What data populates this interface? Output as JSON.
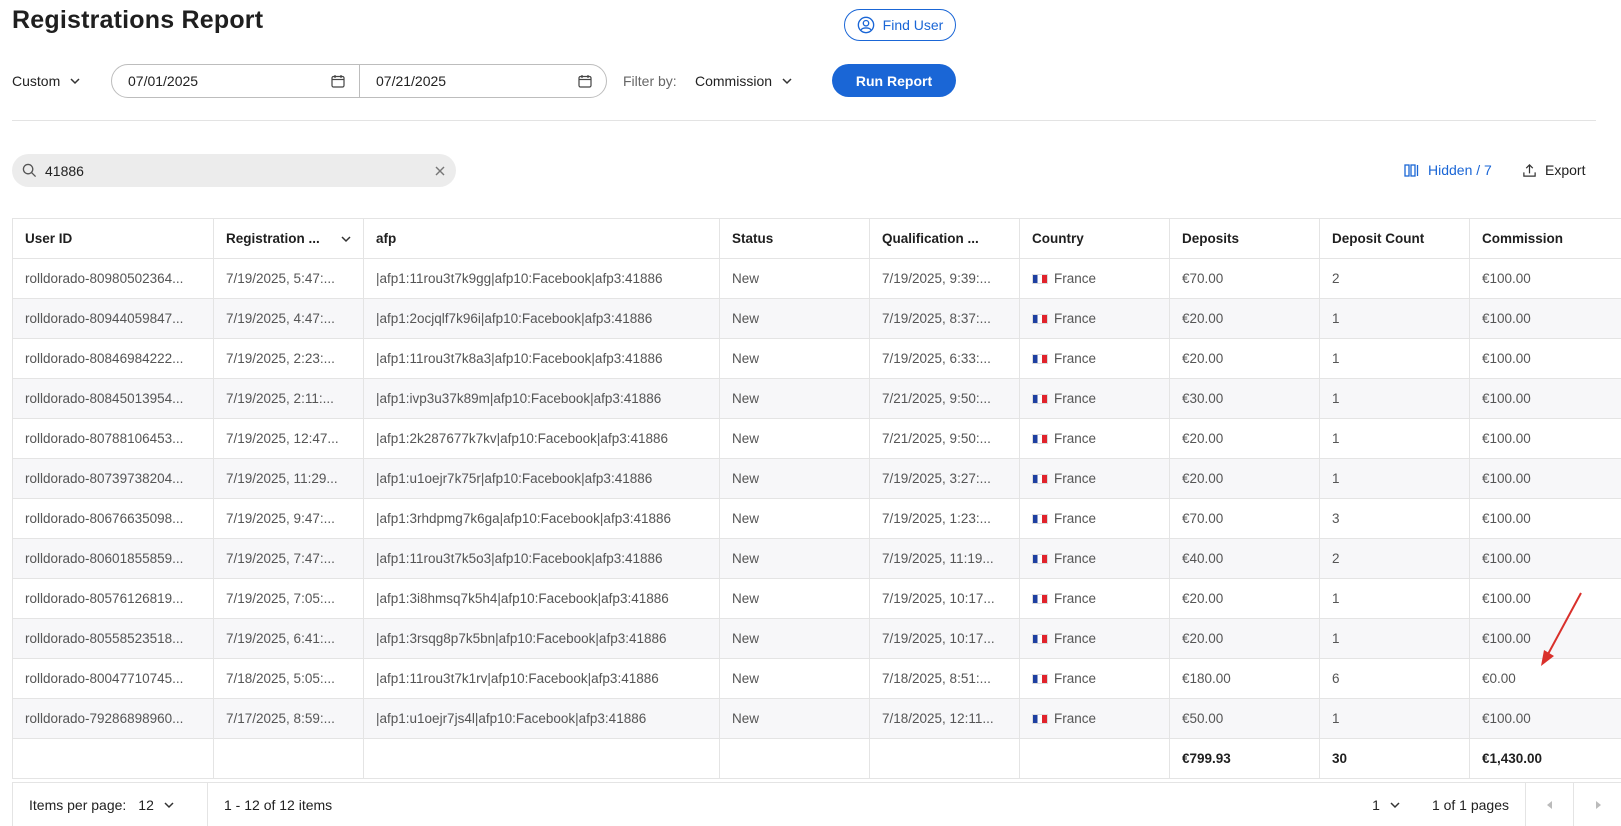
{
  "page": {
    "title": "Registrations Report"
  },
  "find_user": {
    "label": "Find User",
    "icon": "user-circle-icon"
  },
  "toolbar": {
    "range_label": "Custom",
    "start_date": "07/01/2025",
    "end_date": "07/21/2025",
    "filter_label": "Filter by:",
    "filter_value": "Commission",
    "run_label": "Run Report"
  },
  "search": {
    "value": "41886"
  },
  "actions": {
    "hidden_label": "Hidden / 7",
    "export_label": "Export"
  },
  "table": {
    "columns": [
      "User ID",
      "Registration ...",
      "afp",
      "Status",
      "Qualification ...",
      "Country",
      "Deposits",
      "Deposit Count",
      "Commission"
    ],
    "rows": [
      [
        "rolldorado-80980502364...",
        "7/19/2025, 5:47:...",
        "|afp1:11rou3t7k9gg|afp10:Facebook|afp3:41886",
        "New",
        "7/19/2025, 9:39:...",
        "France",
        "€70.00",
        "2",
        "€100.00"
      ],
      [
        "rolldorado-80944059847...",
        "7/19/2025, 4:47:...",
        "|afp1:2ocjqlf7k96i|afp10:Facebook|afp3:41886",
        "New",
        "7/19/2025, 8:37:...",
        "France",
        "€20.00",
        "1",
        "€100.00"
      ],
      [
        "rolldorado-80846984222...",
        "7/19/2025, 2:23:...",
        "|afp1:11rou3t7k8a3|afp10:Facebook|afp3:41886",
        "New",
        "7/19/2025, 6:33:...",
        "France",
        "€20.00",
        "1",
        "€100.00"
      ],
      [
        "rolldorado-80845013954...",
        "7/19/2025, 2:11:...",
        "|afp1:ivp3u37k89m|afp10:Facebook|afp3:41886",
        "New",
        "7/21/2025, 9:50:...",
        "France",
        "€30.00",
        "1",
        "€100.00"
      ],
      [
        "rolldorado-80788106453...",
        "7/19/2025, 12:47...",
        "|afp1:2k287677k7kv|afp10:Facebook|afp3:41886",
        "New",
        "7/21/2025, 9:50:...",
        "France",
        "€20.00",
        "1",
        "€100.00"
      ],
      [
        "rolldorado-80739738204...",
        "7/19/2025, 11:29...",
        "|afp1:u1oejr7k75r|afp10:Facebook|afp3:41886",
        "New",
        "7/19/2025, 3:27:...",
        "France",
        "€20.00",
        "1",
        "€100.00"
      ],
      [
        "rolldorado-80676635098...",
        "7/19/2025, 9:47:...",
        "|afp1:3rhdpmg7k6ga|afp10:Facebook|afp3:41886",
        "New",
        "7/19/2025, 1:23:...",
        "France",
        "€70.00",
        "3",
        "€100.00"
      ],
      [
        "rolldorado-80601855859...",
        "7/19/2025, 7:47:...",
        "|afp1:11rou3t7k5o3|afp10:Facebook|afp3:41886",
        "New",
        "7/19/2025, 11:19...",
        "France",
        "€40.00",
        "2",
        "€100.00"
      ],
      [
        "rolldorado-80576126819...",
        "7/19/2025, 7:05:...",
        "|afp1:3i8hmsq7k5h4|afp10:Facebook|afp3:41886",
        "New",
        "7/19/2025, 10:17...",
        "France",
        "€20.00",
        "1",
        "€100.00"
      ],
      [
        "rolldorado-80558523518...",
        "7/19/2025, 6:41:...",
        "|afp1:3rsqg8p7k5bn|afp10:Facebook|afp3:41886",
        "New",
        "7/19/2025, 10:17...",
        "France",
        "€20.00",
        "1",
        "€100.00"
      ],
      [
        "rolldorado-80047710745...",
        "7/18/2025, 5:05:...",
        "|afp1:11rou3t7k1rv|afp10:Facebook|afp3:41886",
        "New",
        "7/18/2025, 8:51:...",
        "France",
        "€180.00",
        "6",
        "€0.00"
      ],
      [
        "rolldorado-79286898960...",
        "7/17/2025, 8:59:...",
        "|afp1:u1oejr7js4l|afp10:Facebook|afp3:41886",
        "New",
        "7/18/2025, 12:11...",
        "France",
        "€50.00",
        "1",
        "€100.00"
      ]
    ],
    "totals": {
      "deposits": "€799.93",
      "deposit_count": "30",
      "commission": "€1,430.00"
    }
  },
  "footer": {
    "items_per_page_label": "Items per page:",
    "items_per_page_value": "12",
    "range_text": "1 - 12 of 12 items",
    "page_value": "1",
    "page_of": "1 of 1 pages"
  },
  "colors": {
    "accent": "#1a66d6",
    "annotation": "#d9302b"
  }
}
